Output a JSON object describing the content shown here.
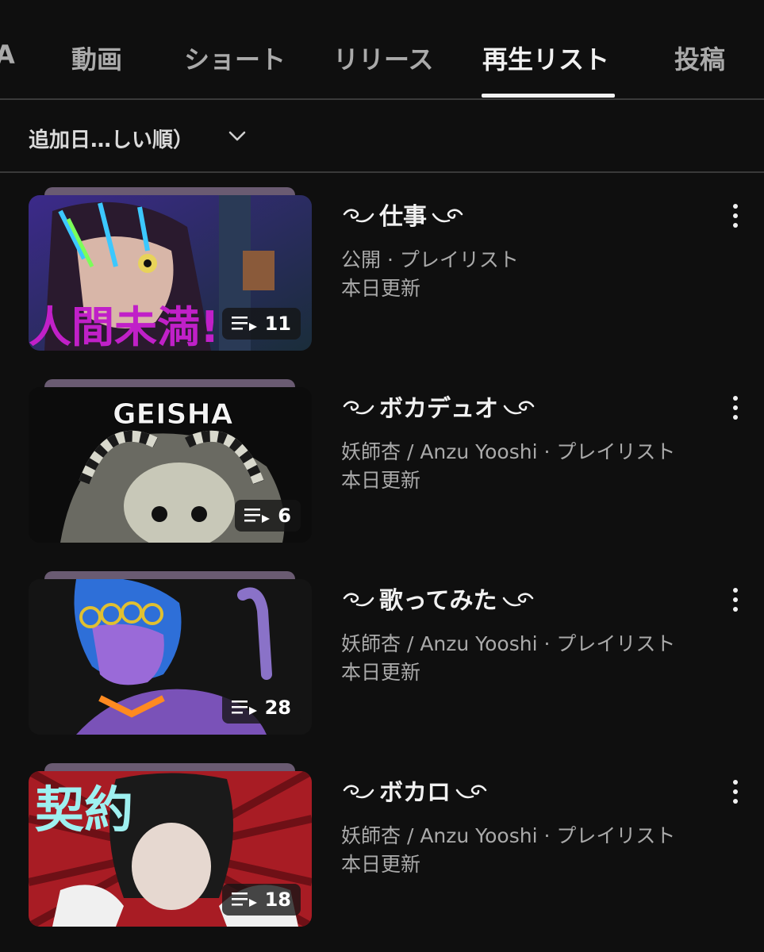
{
  "tabs": [
    {
      "label": "A"
    },
    {
      "label": "動画"
    },
    {
      "label": "ショート"
    },
    {
      "label": "リリース"
    },
    {
      "label": "再生リスト",
      "active": true
    },
    {
      "label": "投稿"
    }
  ],
  "sort": {
    "label": "追加日…しい順）",
    "icon": "chevron-down-icon"
  },
  "playlists": [
    {
      "title": "仕事",
      "visibility": "公開 · プレイリスト",
      "updated": "本日更新",
      "count": "11",
      "thumb_text": "人間未満!"
    },
    {
      "title": "ボカデュオ",
      "visibility": "妖師杏 / Anzu Yooshi · プレイリスト",
      "updated": "本日更新",
      "count": "6",
      "thumb_text": "GEISHA"
    },
    {
      "title": "歌ってみた",
      "visibility": "妖師杏 / Anzu Yooshi · プレイリスト",
      "updated": "本日更新",
      "count": "28",
      "thumb_text": ""
    },
    {
      "title": "ボカロ",
      "visibility": "妖師杏 / Anzu Yooshi · プレイリスト",
      "updated": "本日更新",
      "count": "18",
      "thumb_text": "契約"
    }
  ],
  "colors": {
    "background": "#0f0f0f",
    "text": "#f1f1f1",
    "secondary": "#aaaaaa",
    "divider": "#3a3a3a"
  }
}
